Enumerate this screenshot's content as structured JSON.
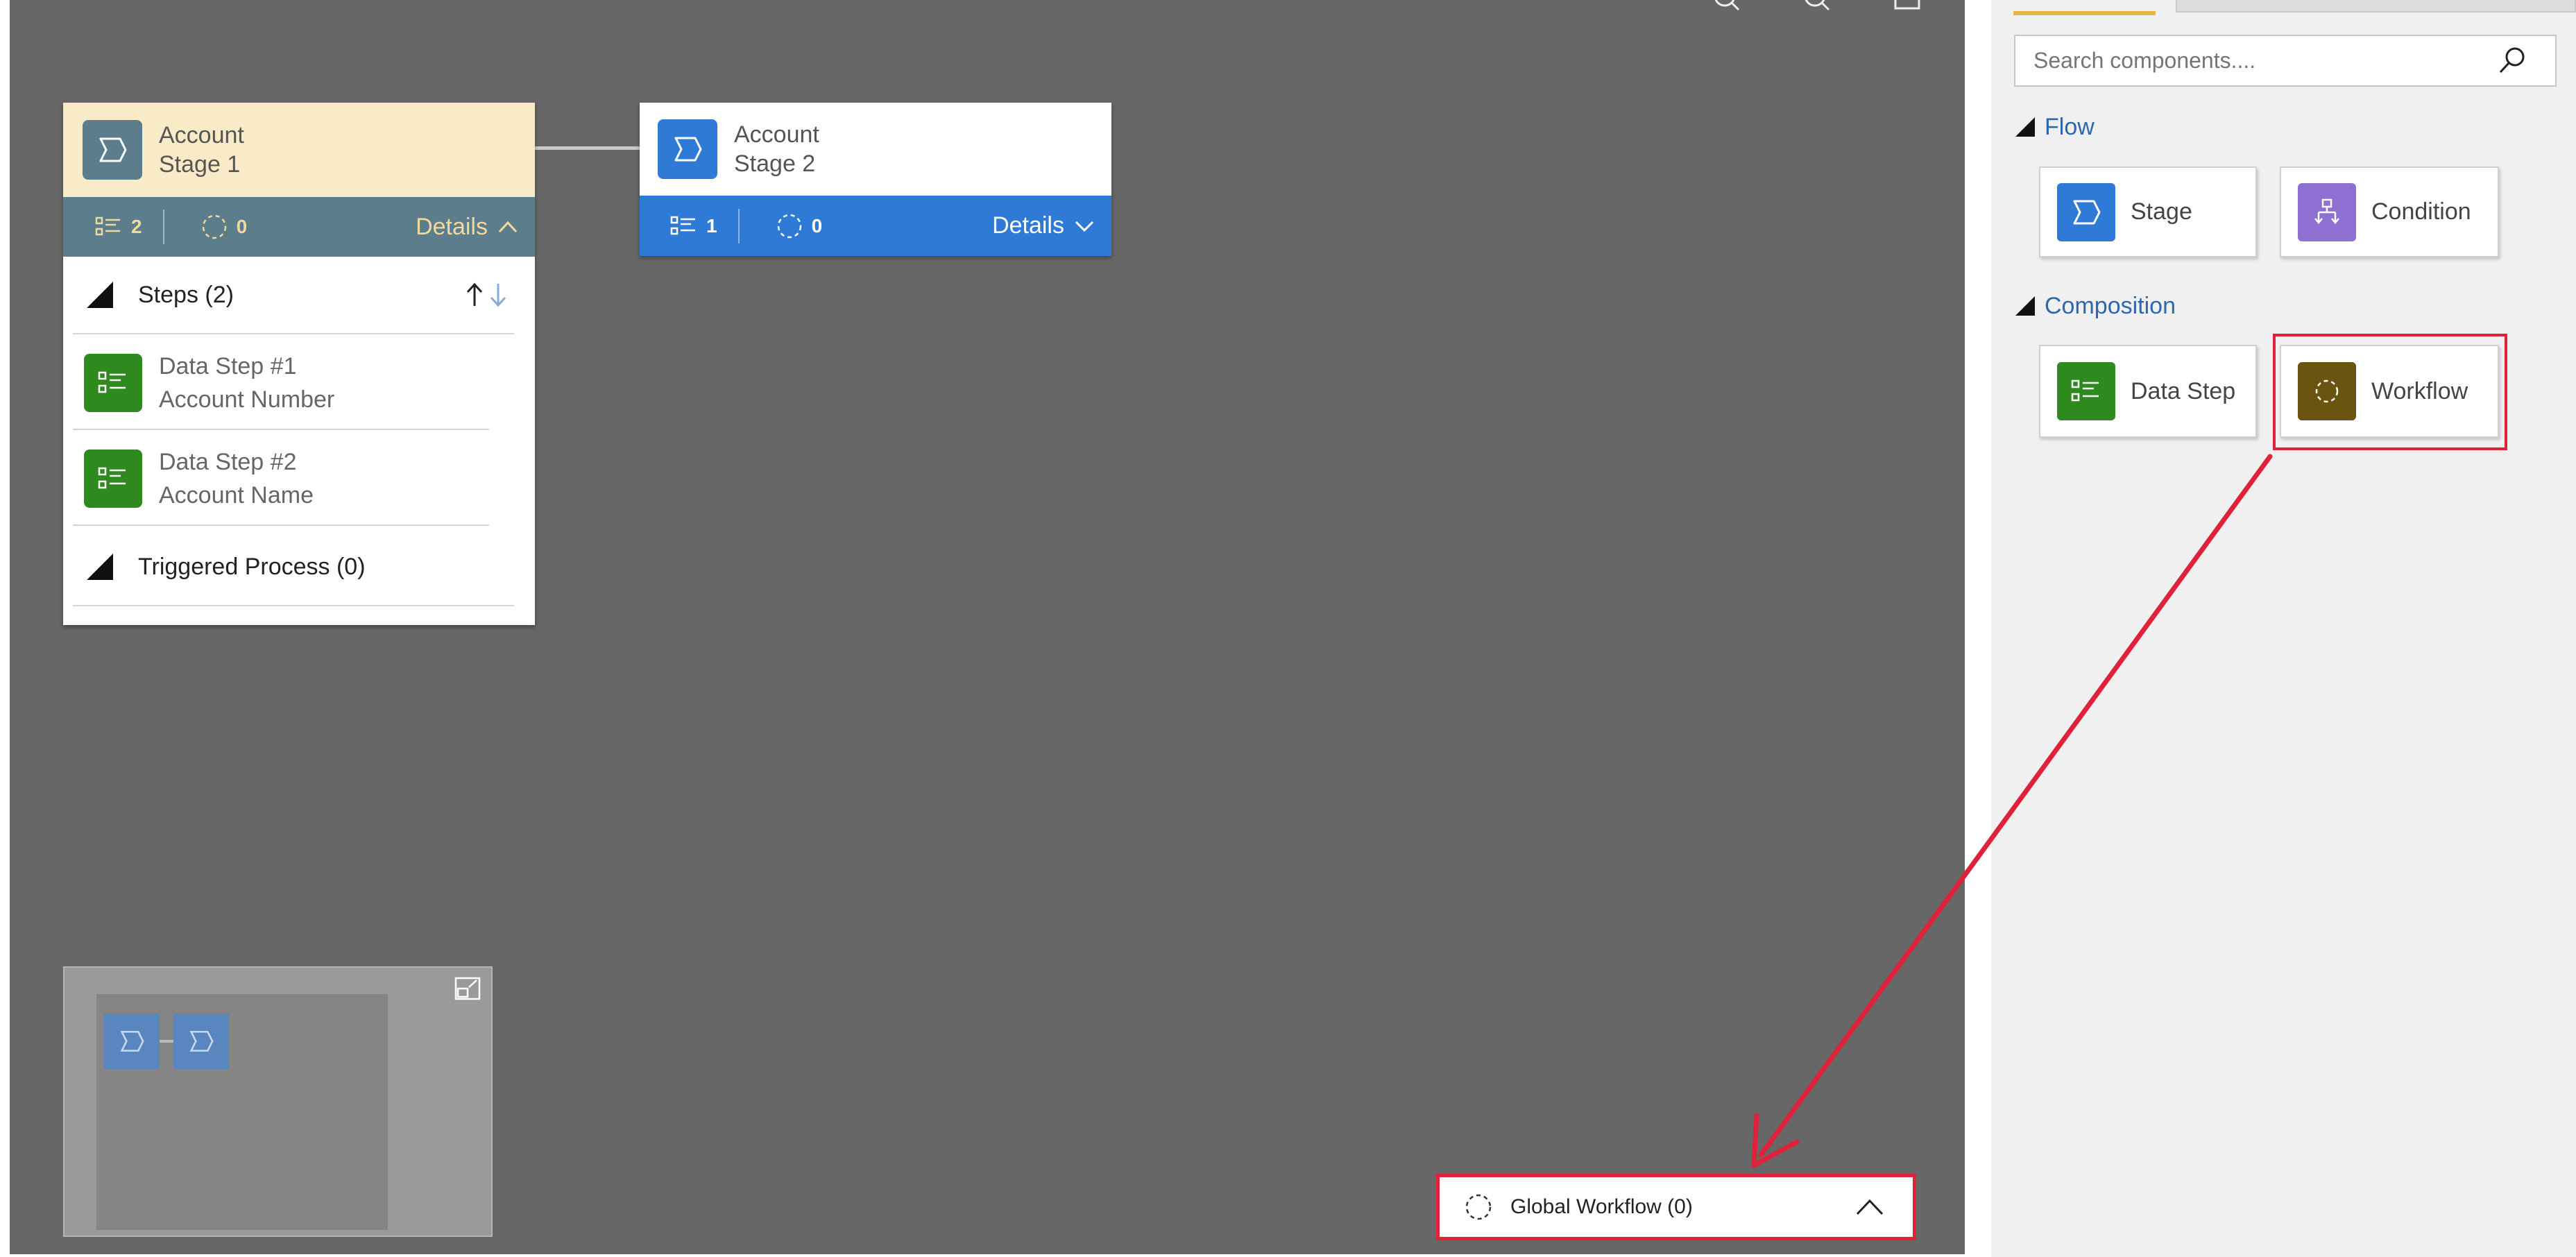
{
  "stage1": {
    "entity": "Account",
    "name": "Stage 1",
    "steps_count": "2",
    "workflow_count": "0",
    "details_label": "Details",
    "steps_header": "Steps (2)",
    "steps": [
      {
        "title": "Data Step #1",
        "field": "Account Number"
      },
      {
        "title": "Data Step #2",
        "field": "Account Name"
      }
    ],
    "triggered_label": "Triggered Process (0)"
  },
  "stage2": {
    "entity": "Account",
    "name": "Stage 2",
    "steps_count": "1",
    "workflow_count": "0",
    "details_label": "Details"
  },
  "global_workflow": {
    "label": "Global Workflow (0)"
  },
  "sidebar": {
    "search": {
      "placeholder": "Search components...."
    },
    "sections": [
      {
        "title": "Flow",
        "items": [
          "Stage",
          "Condition"
        ]
      },
      {
        "title": "Composition",
        "items": [
          "Data Step",
          "Workflow"
        ]
      }
    ]
  },
  "colors": {
    "canvas": "#676767",
    "stage_active_header": "#faebc8",
    "stage_active_bar": "#5c7d8c",
    "stage_blue": "#2f7ad6",
    "data_step_green": "#2e8a1e",
    "condition_purple": "#8f6fd1",
    "workflow_brown": "#6b5410",
    "highlight_red": "#e0213a"
  }
}
